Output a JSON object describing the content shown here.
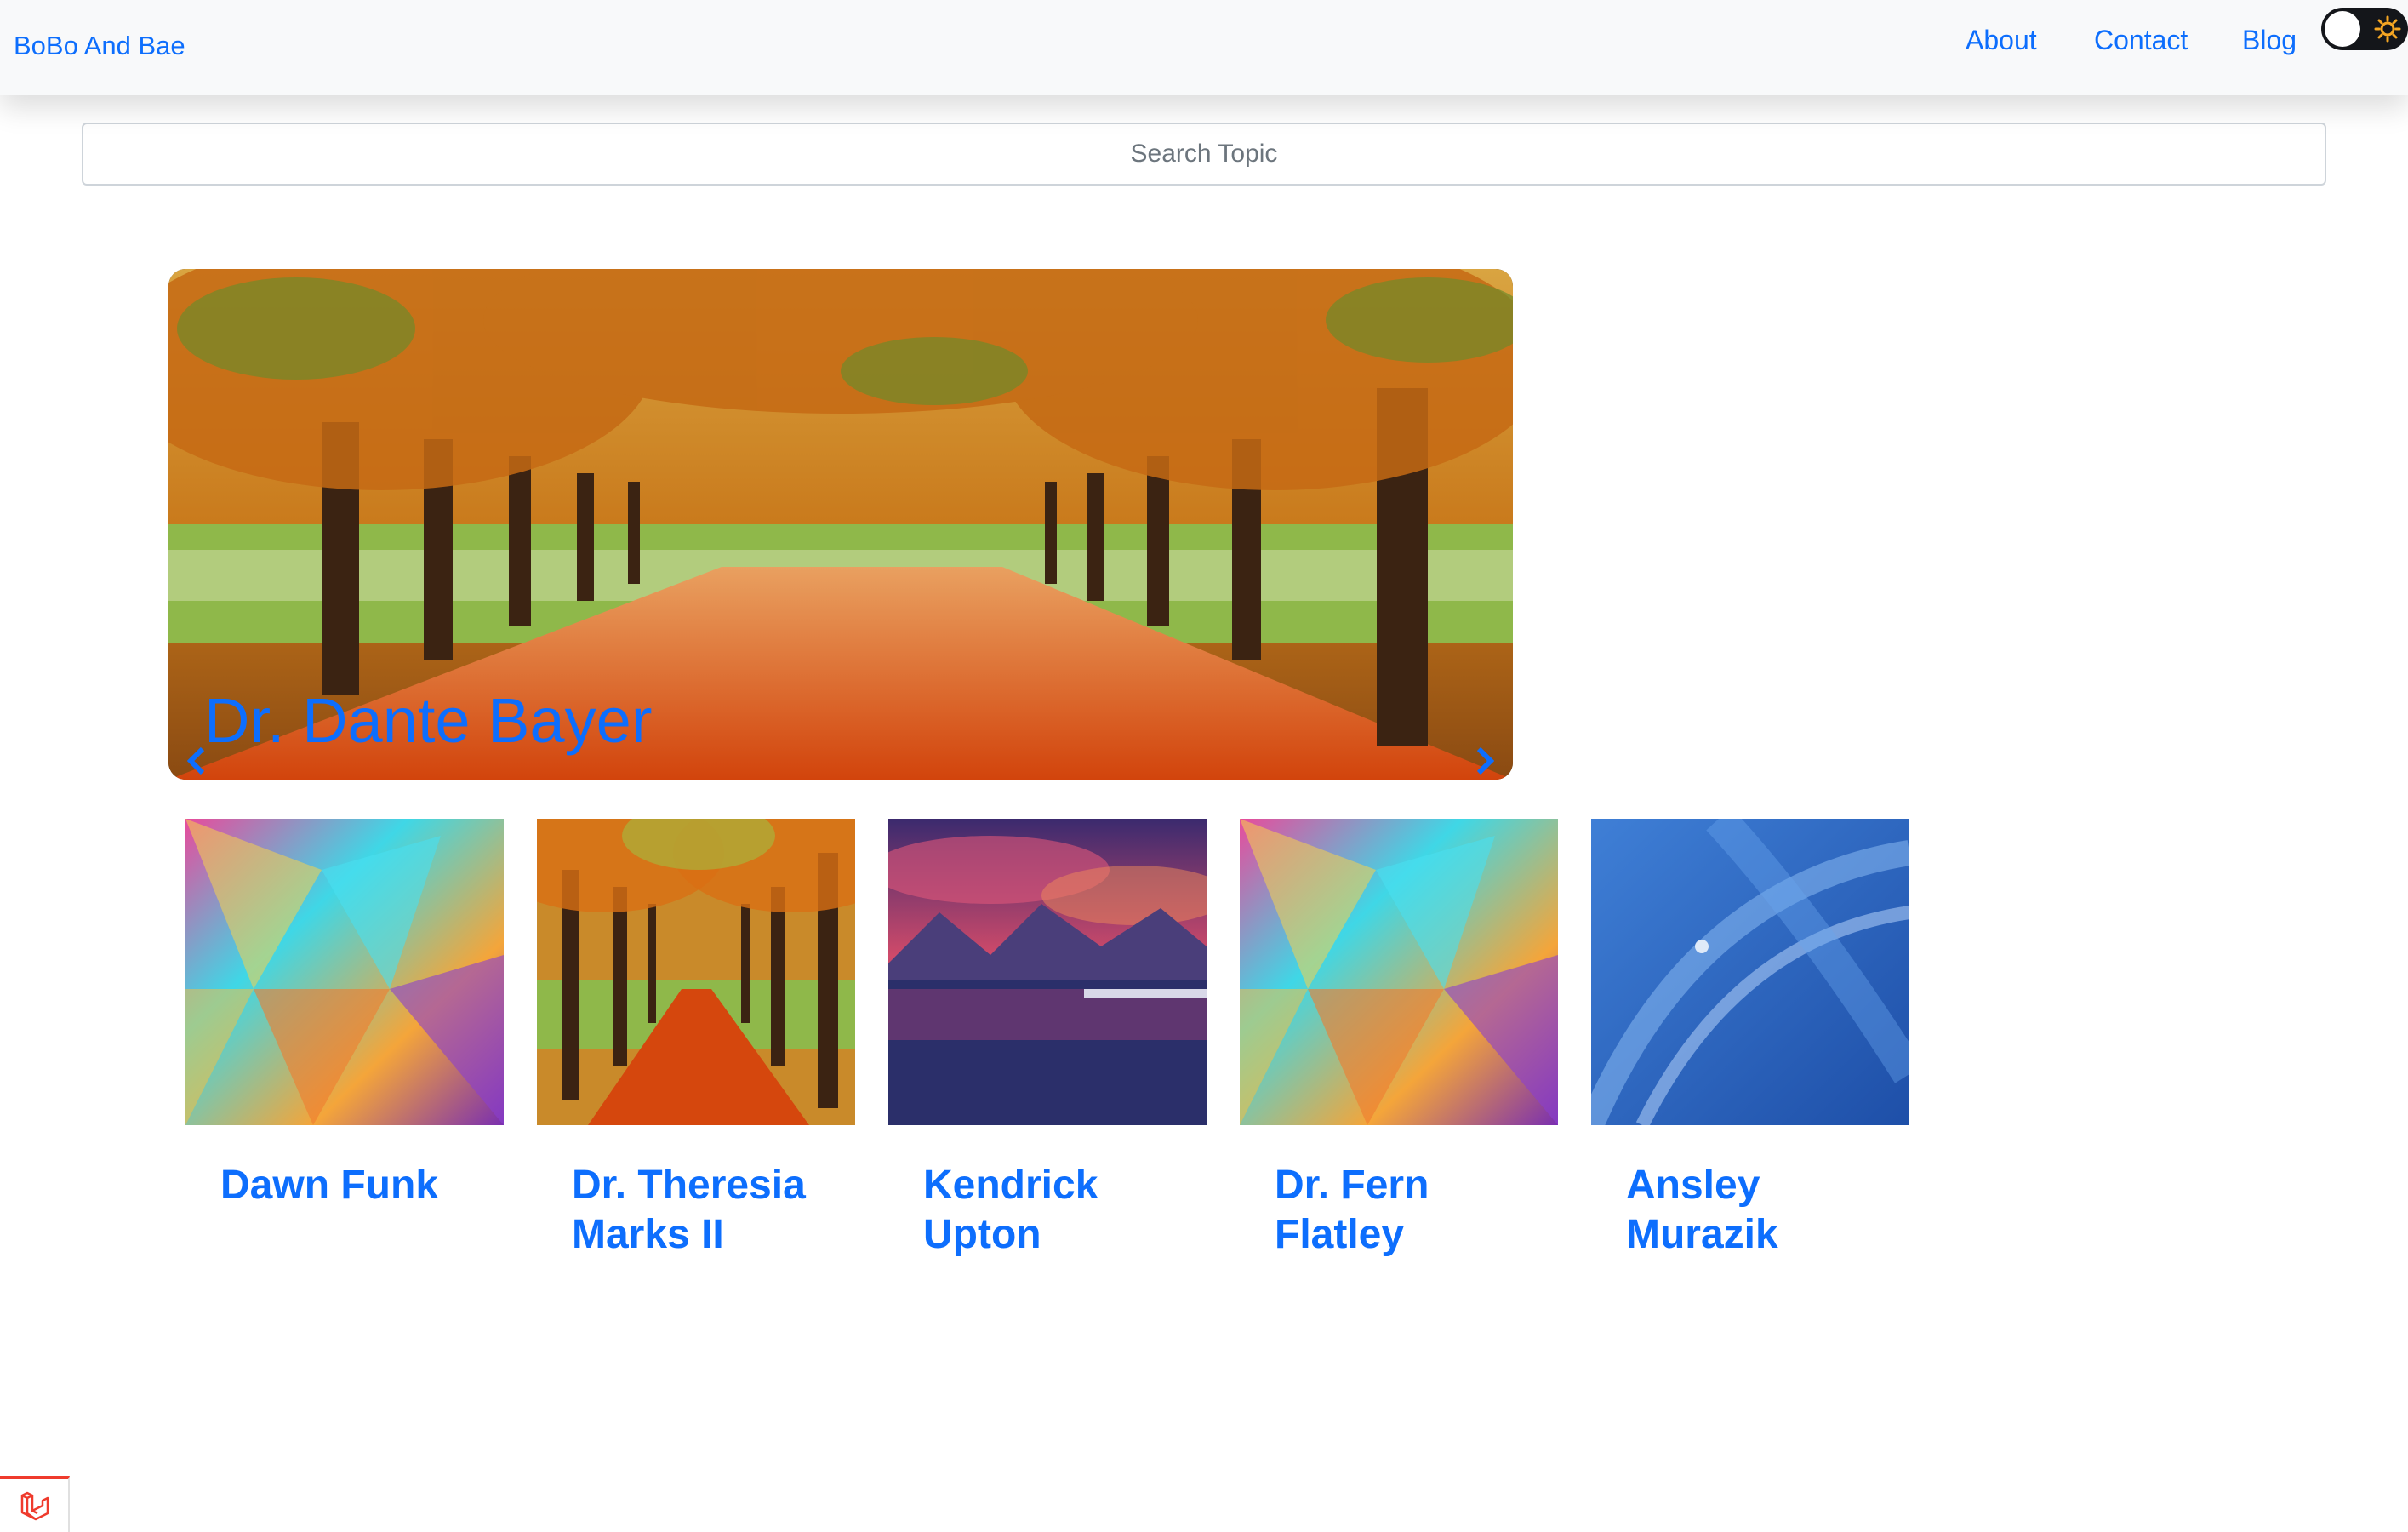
{
  "navbar": {
    "brand": "BoBo And Bae",
    "links": [
      {
        "label": "About"
      },
      {
        "label": "Contact"
      },
      {
        "label": "Blog"
      }
    ],
    "theme_toggle": {
      "state": "light",
      "icon": "sun-icon"
    }
  },
  "search": {
    "placeholder": "Search Topic",
    "value": ""
  },
  "carousel": {
    "active_caption": "Dr. Dante Bayer",
    "image": "autumn-trees-path",
    "prev_icon": "chevron-left-icon",
    "next_icon": "chevron-right-icon"
  },
  "cards": [
    {
      "title": "Dawn Funk",
      "image": "colorful-crystal-abstract"
    },
    {
      "title": "Dr. Theresia Marks II",
      "image": "autumn-trees-path"
    },
    {
      "title": "Kendrick Upton",
      "image": "mountain-lake-sunset"
    },
    {
      "title": "Dr. Fern Flatley",
      "image": "colorful-crystal-abstract"
    },
    {
      "title": "Ansley Murazik",
      "image": "blue-abstract-curves"
    }
  ],
  "colors": {
    "accent": "#0d6efd",
    "navbar_bg": "#f8f9fa",
    "toggle_bg": "#14161a",
    "sun": "#f5a623",
    "laravel_red": "#ef3b2d"
  },
  "footer": {
    "dev_toolbar_icon": "laravel-logo-icon"
  }
}
